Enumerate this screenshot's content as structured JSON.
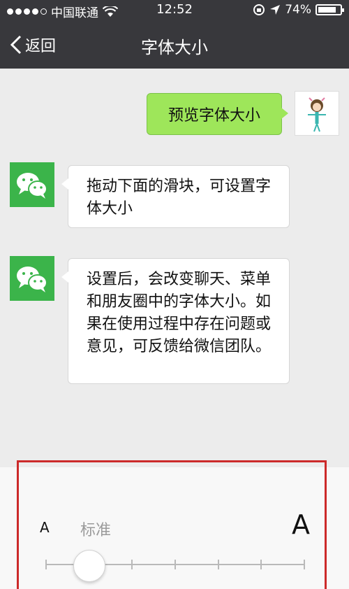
{
  "status_bar": {
    "carrier": "中国联通",
    "time": "12:52",
    "battery": "74%"
  },
  "nav": {
    "back_label": "返回",
    "title": "字体大小"
  },
  "chat": {
    "preview_message": "预览字体大小",
    "message_1": "拖动下面的滑块，可设置字体大小",
    "message_2": "设置后，会改变聊天、菜单和朋友圈中的字体大小。如果在使用过程中存在问题或意见，可反馈给微信团队。"
  },
  "font_slider": {
    "small_label": "A",
    "current_label": "标准",
    "large_label": "A",
    "level_index": 1,
    "level_count": 7
  },
  "colors": {
    "nav_background": "#38383c",
    "bubble_green": "#9ee65a",
    "wechat_green": "#3bb44a",
    "highlight_frame": "#cc2a2a"
  }
}
